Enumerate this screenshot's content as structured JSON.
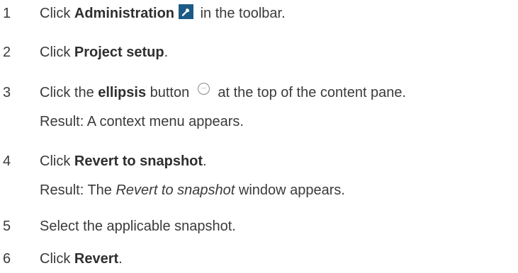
{
  "steps": [
    {
      "number": "1",
      "pre": "Click ",
      "bold": "Administration",
      "post": " in the toolbar.",
      "icon": "wrench-icon"
    },
    {
      "number": "2",
      "pre": "Click ",
      "bold": "Project setup",
      "post": "."
    },
    {
      "number": "3",
      "pre": "Click the ",
      "bold": "ellipsis",
      "mid": " button ",
      "post": " at the top of the content pane.",
      "icon": "ellipsis-icon",
      "result": "Result: A context menu appears."
    },
    {
      "number": "4",
      "pre": "Click ",
      "bold": "Revert to snapshot",
      "post": ".",
      "result_pre": "Result: The ",
      "result_italic": "Revert to snapshot",
      "result_post": " window appears."
    },
    {
      "number": "5",
      "text": "Select the applicable snapshot."
    },
    {
      "number": "6",
      "pre": "Click ",
      "bold": "Revert",
      "post": "."
    }
  ],
  "colors": {
    "text": "#3a3a3a",
    "admin_icon_bg": "#1d5a86"
  }
}
